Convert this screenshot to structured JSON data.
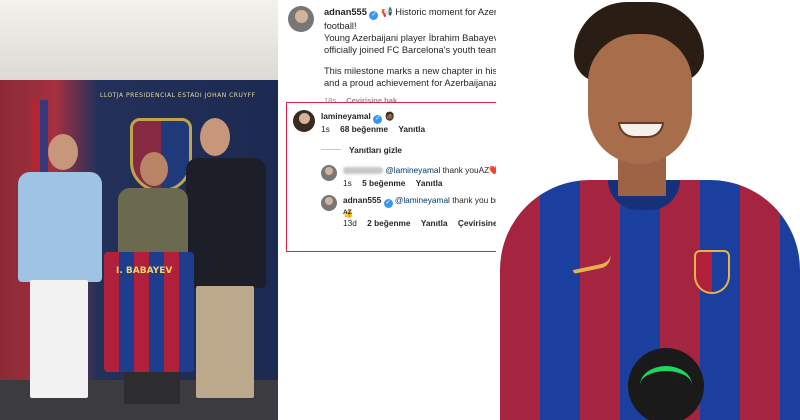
{
  "left_photo": {
    "sign_text": "LLOTJA PRESIDENCIAL ESTADI JOHAN CRUYFF",
    "jersey_name": "I. BABAYEV"
  },
  "post": {
    "username": "adnan555",
    "emoji": "📢",
    "line1": "Historic moment for Azerbaijani football!",
    "line2": "Young Azerbaijani player İbrahim Babayev has officially joined FC Barcelona's youth team.",
    "line3": "This milestone marks a new chapter in his career and a proud achievement for Azerbaijanaz",
    "time": "18s",
    "translate": "Çevirisine bak"
  },
  "comment": {
    "username": "lamineyamal",
    "text": "🧔🏾",
    "time": "1s",
    "likes": "68 beğenme",
    "reply": "Yanıtla",
    "hide_replies": "Yanıtları gizle"
  },
  "reply1": {
    "mention": "@lamineyamal",
    "text": "thank youAZ❤️",
    "time": "1s",
    "likes": "5 beğenme",
    "reply": "Yanıtla"
  },
  "reply2": {
    "username": "adnan555",
    "mention": "@lamineyamal",
    "text": "thank you brother 🙏👍",
    "text2": "AZ",
    "time": "13d",
    "likes": "2 beğenme",
    "reply": "Yanıtla",
    "translate": "Çevirisine bak"
  },
  "colors": {
    "verified": "#3897f0",
    "highlight_border": "#e0234d",
    "mention": "#00376b"
  }
}
